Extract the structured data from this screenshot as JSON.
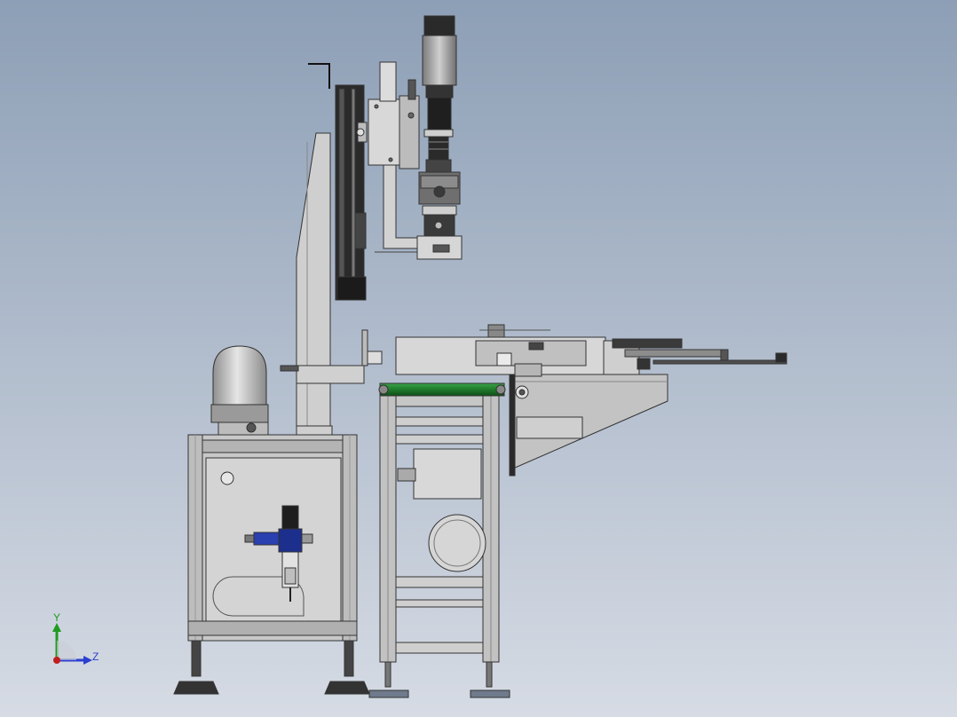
{
  "viewport": {
    "background_top": "#8d9fb6",
    "background_bottom": "#d6dbe4"
  },
  "model": {
    "frame_color": "#c4c4c4",
    "panel_color": "#d2d2d2",
    "dark_color": "#2a2a2a",
    "roller_color": "#1f7a2a",
    "regulator_color": "#1d2f8c"
  },
  "triad": {
    "y_label": "Y",
    "z_label": "Z",
    "y_color": "#1f9b1f",
    "z_color": "#2a3fd0",
    "origin_color": "#c01e1e"
  }
}
